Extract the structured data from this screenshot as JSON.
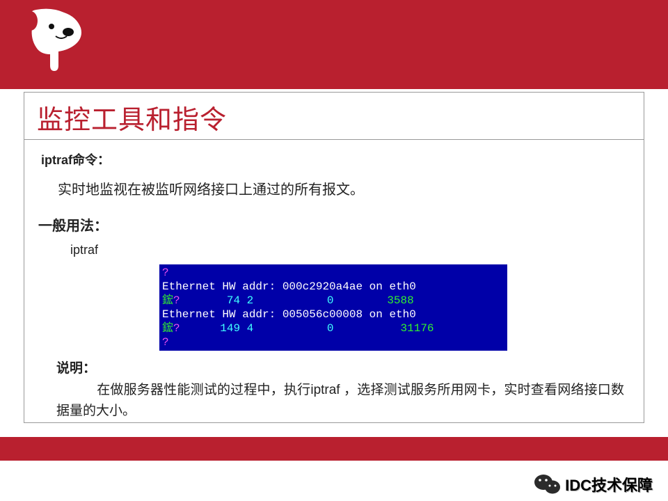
{
  "header": {
    "logo_alt": "dog-mascot-logo"
  },
  "title": "监控工具和指令",
  "cmd": {
    "label": "iptraf命令：",
    "desc": "实时地监视在被监听网络接口上通过的所有报文。"
  },
  "usage": {
    "label": "一般用法：",
    "command": "iptraf"
  },
  "terminal": {
    "l1_q": "?",
    "l2": "Ethernet HW addr: 000c2920a4ae on eth0",
    "l3_a": "鋐",
    "l3_q": "?",
    "l3_v1": "74",
    "l3_v2": "2",
    "l3_v3": "0",
    "l3_v4": "3588",
    "l4": "Ethernet HW addr: 005056c00008 on eth0",
    "l5_a": "鋐",
    "l5_q": "?",
    "l5_v1": "149",
    "l5_v2": "4",
    "l5_v3": "0",
    "l5_v4": "31176",
    "l6_q": "?"
  },
  "note": {
    "label": "说明：",
    "text": "在做服务器性能测试的过程中，执行iptraf ，选择测试服务所用网卡，实时查看网络接口数据量的大小。"
  },
  "footer": {
    "text": "IDC技术保障"
  }
}
